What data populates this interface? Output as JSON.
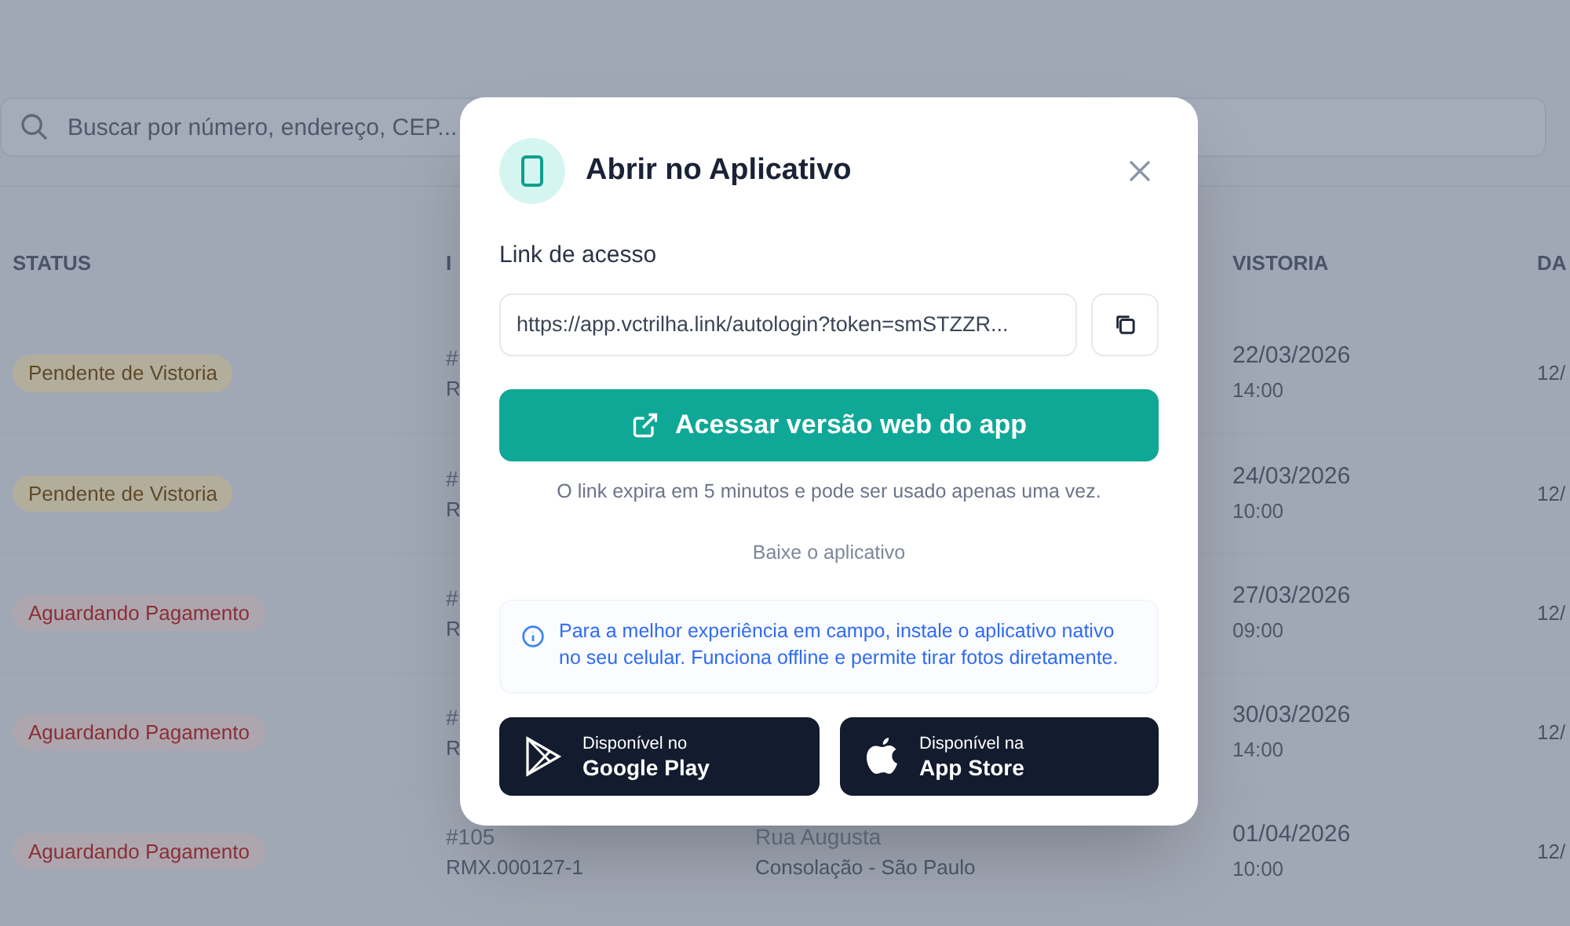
{
  "search": {
    "placeholder": "Buscar por número, endereço, CEP..."
  },
  "table": {
    "columns": {
      "status": "STATUS",
      "id": "I",
      "vistoria": "VISTORIA",
      "column_5": "DA"
    },
    "rows": [
      {
        "status": {
          "label": "Pendente de Vistoria",
          "kind": "pending"
        },
        "id": "#",
        "code": "R",
        "date": "22/03/2026",
        "time": "14:00",
        "column_5": "12/"
      },
      {
        "status": {
          "label": "Pendente de Vistoria",
          "kind": "pending"
        },
        "id": "#",
        "code": "R",
        "date": "24/03/2026",
        "time": "10:00",
        "column_5": "12/"
      },
      {
        "status": {
          "label": "Aguardando Pagamento",
          "kind": "awaiting"
        },
        "id": "#",
        "code": "R",
        "date": "27/03/2026",
        "time": "09:00",
        "column_5": "12/"
      },
      {
        "status": {
          "label": "Aguardando Pagamento",
          "kind": "awaiting"
        },
        "id": "#",
        "code": "R",
        "date": "30/03/2026",
        "time": "14:00",
        "column_5": "12/"
      },
      {
        "status": {
          "label": "Aguardando Pagamento",
          "kind": "awaiting"
        },
        "id": "#105",
        "code": "RMX.000127-1",
        "address": "Rua Augusta",
        "district": "Consolação - São Paulo",
        "date": "01/04/2026",
        "time": "10:00",
        "column_5": "12/"
      }
    ]
  },
  "dialog": {
    "title": "Abrir no Aplicativo",
    "link_label": "Link de acesso",
    "link_value": "https://app.vctrilha.link/autologin?token=smSTZZR...",
    "open_button": "Acessar versão web do app",
    "note": "O link expira em 5 minutos e pode ser usado apenas uma vez.",
    "download_label": "Baixe o aplicativo",
    "info": "Para a melhor experiência em campo, instale o aplicativo nativo no seu celular. Funciona offline e permite tirar fotos diretamente.",
    "stores": [
      {
        "kind": "google",
        "caption": "Disponível no",
        "name": "Google Play"
      },
      {
        "kind": "apple",
        "caption": "Disponível na",
        "name": "App Store"
      }
    ]
  }
}
